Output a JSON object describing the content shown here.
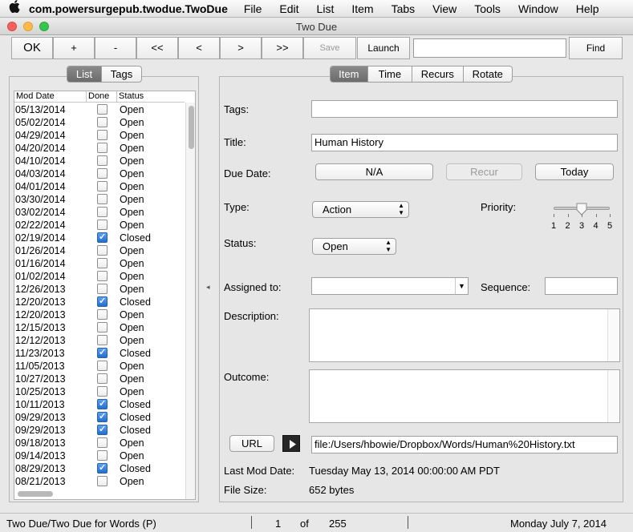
{
  "menubar": {
    "app_name": "com.powersurgepub.twodue.TwoDue",
    "items": [
      "File",
      "Edit",
      "List",
      "Item",
      "Tabs",
      "View",
      "Tools",
      "Window",
      "Help"
    ]
  },
  "window": {
    "title": "Two Due"
  },
  "toolbar": {
    "ok": "OK",
    "add": "+",
    "remove": "-",
    "first": "<<",
    "prev": "<",
    "next": ">",
    "last": ">>",
    "save": "Save",
    "launch": "Launch",
    "find": "Find",
    "find_value": ""
  },
  "left": {
    "tabs": [
      "List",
      "Tags"
    ],
    "selected_tab": "List",
    "columns": [
      "Mod Date",
      "Done",
      "Status"
    ],
    "rows": [
      {
        "date": "05/13/2014",
        "done": false,
        "status": "Open"
      },
      {
        "date": "05/02/2014",
        "done": false,
        "status": "Open"
      },
      {
        "date": "04/29/2014",
        "done": false,
        "status": "Open"
      },
      {
        "date": "04/20/2014",
        "done": false,
        "status": "Open"
      },
      {
        "date": "04/10/2014",
        "done": false,
        "status": "Open"
      },
      {
        "date": "04/03/2014",
        "done": false,
        "status": "Open"
      },
      {
        "date": "04/01/2014",
        "done": false,
        "status": "Open"
      },
      {
        "date": "03/30/2014",
        "done": false,
        "status": "Open"
      },
      {
        "date": "03/02/2014",
        "done": false,
        "status": "Open"
      },
      {
        "date": "02/22/2014",
        "done": false,
        "status": "Open"
      },
      {
        "date": "02/19/2014",
        "done": true,
        "status": "Closed"
      },
      {
        "date": "01/26/2014",
        "done": false,
        "status": "Open"
      },
      {
        "date": "01/16/2014",
        "done": false,
        "status": "Open"
      },
      {
        "date": "01/02/2014",
        "done": false,
        "status": "Open"
      },
      {
        "date": "12/26/2013",
        "done": false,
        "status": "Open"
      },
      {
        "date": "12/20/2013",
        "done": true,
        "status": "Closed"
      },
      {
        "date": "12/20/2013",
        "done": false,
        "status": "Open"
      },
      {
        "date": "12/15/2013",
        "done": false,
        "status": "Open"
      },
      {
        "date": "12/12/2013",
        "done": false,
        "status": "Open"
      },
      {
        "date": "11/23/2013",
        "done": true,
        "status": "Closed"
      },
      {
        "date": "11/05/2013",
        "done": false,
        "status": "Open"
      },
      {
        "date": "10/27/2013",
        "done": false,
        "status": "Open"
      },
      {
        "date": "10/25/2013",
        "done": false,
        "status": "Open"
      },
      {
        "date": "10/11/2013",
        "done": true,
        "status": "Closed"
      },
      {
        "date": "09/29/2013",
        "done": true,
        "status": "Closed"
      },
      {
        "date": "09/29/2013",
        "done": true,
        "status": "Closed"
      },
      {
        "date": "09/18/2013",
        "done": false,
        "status": "Open"
      },
      {
        "date": "09/14/2013",
        "done": false,
        "status": "Open"
      },
      {
        "date": "08/29/2013",
        "done": true,
        "status": "Closed"
      },
      {
        "date": "08/21/2013",
        "done": false,
        "status": "Open"
      }
    ]
  },
  "right": {
    "tabs": [
      "Item",
      "Time",
      "Recurs",
      "Rotate"
    ],
    "selected_tab": "Item",
    "tags_label": "Tags:",
    "tags_value": "",
    "title_label": "Title:",
    "title_value": "Human History",
    "due_label": "Due Date:",
    "due_button": "N/A",
    "recur_button": "Recur",
    "today_button": "Today",
    "type_label": "Type:",
    "type_value": "Action",
    "priority_label": "Priority:",
    "priority_ticks": [
      "1",
      "2",
      "3",
      "4",
      "5"
    ],
    "priority_value": 3,
    "status_label": "Status:",
    "status_value": "Open",
    "assigned_label": "Assigned to:",
    "assigned_value": "",
    "sequence_label": "Sequence:",
    "sequence_value": "",
    "description_label": "Description:",
    "outcome_label": "Outcome:",
    "url_button": "URL",
    "url_value": "file:/Users/hbowie/Dropbox/Words/Human%20History.txt",
    "lastmod_label": "Last Mod Date:",
    "lastmod_value": "Tuesday May 13, 2014 00:00:00 AM PDT",
    "filesize_label": "File Size:",
    "filesize_value": "652 bytes"
  },
  "statusbar": {
    "path": "Two Due/Two Due for Words (P)",
    "current": "1",
    "of": "of",
    "total": "255",
    "date": "Monday July 7, 2014"
  },
  "colors": {
    "checkbox_on": "#1f6fd8",
    "segment_selected": "#7a7a7a"
  }
}
